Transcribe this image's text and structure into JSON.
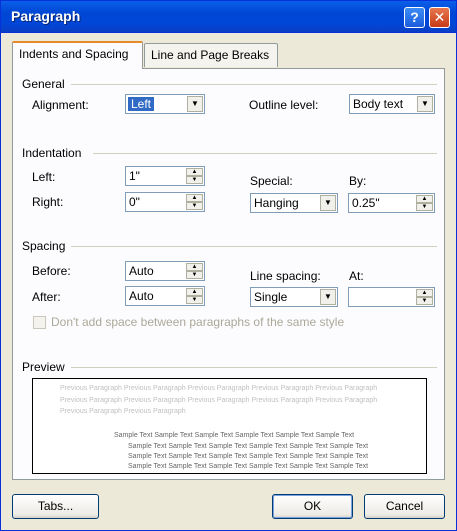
{
  "window": {
    "title": "Paragraph"
  },
  "title_buttons": {
    "help": "?",
    "close": "✕"
  },
  "tabs": [
    {
      "label": "Indents and Spacing",
      "active": true
    },
    {
      "label": "Line and Page Breaks",
      "active": false
    }
  ],
  "general": {
    "section": "General",
    "alignment_label": "Alignment:",
    "alignment_value": "Left",
    "outline_label": "Outline level:",
    "outline_value": "Body text"
  },
  "indentation": {
    "section": "Indentation",
    "left_label": "Left:",
    "left_value": "1\"",
    "right_label": "Right:",
    "right_value": "0\"",
    "special_label": "Special:",
    "special_value": "Hanging",
    "by_label": "By:",
    "by_value": "0.25\""
  },
  "spacing": {
    "section": "Spacing",
    "before_label": "Before:",
    "before_value": "Auto",
    "after_label": "After:",
    "after_value": "Auto",
    "line_spacing_label": "Line spacing:",
    "line_spacing_value": "Single",
    "at_label": "At:",
    "at_value": "",
    "dont_add_label": "Don't add space between paragraphs of the same style",
    "dont_add_checked": false
  },
  "preview": {
    "section": "Preview",
    "previous_lines": [
      "Previous Paragraph Previous Paragraph Previous Paragraph Previous Paragraph Previous Paragraph",
      "Previous Paragraph Previous Paragraph Previous Paragraph Previous Paragraph Previous Paragraph",
      "Previous Paragraph Previous Paragraph"
    ],
    "sample_lines": [
      "Sample Text Sample Text Sample Text Sample Text Sample Text Sample Text",
      "Sample Text Sample Text Sample Text Sample Text Sample Text Sample Text",
      "Sample Text Sample Text Sample Text Sample Text Sample Text Sample Text",
      "Sample Text Sample Text Sample Text Sample Text Sample Text Sample Text"
    ]
  },
  "buttons": {
    "tabs": "Tabs...",
    "ok": "OK",
    "cancel": "Cancel"
  },
  "colors": {
    "title_bar": "#0054e3",
    "dialog_bg": "#ece9d8",
    "selection": "#316ac5",
    "close": "#c83a17"
  },
  "icons": {
    "help": "question-mark-icon",
    "close": "close-x-icon",
    "dropdown": "chevron-down-icon",
    "spin_up": "triangle-up-icon",
    "spin_down": "triangle-down-icon"
  }
}
